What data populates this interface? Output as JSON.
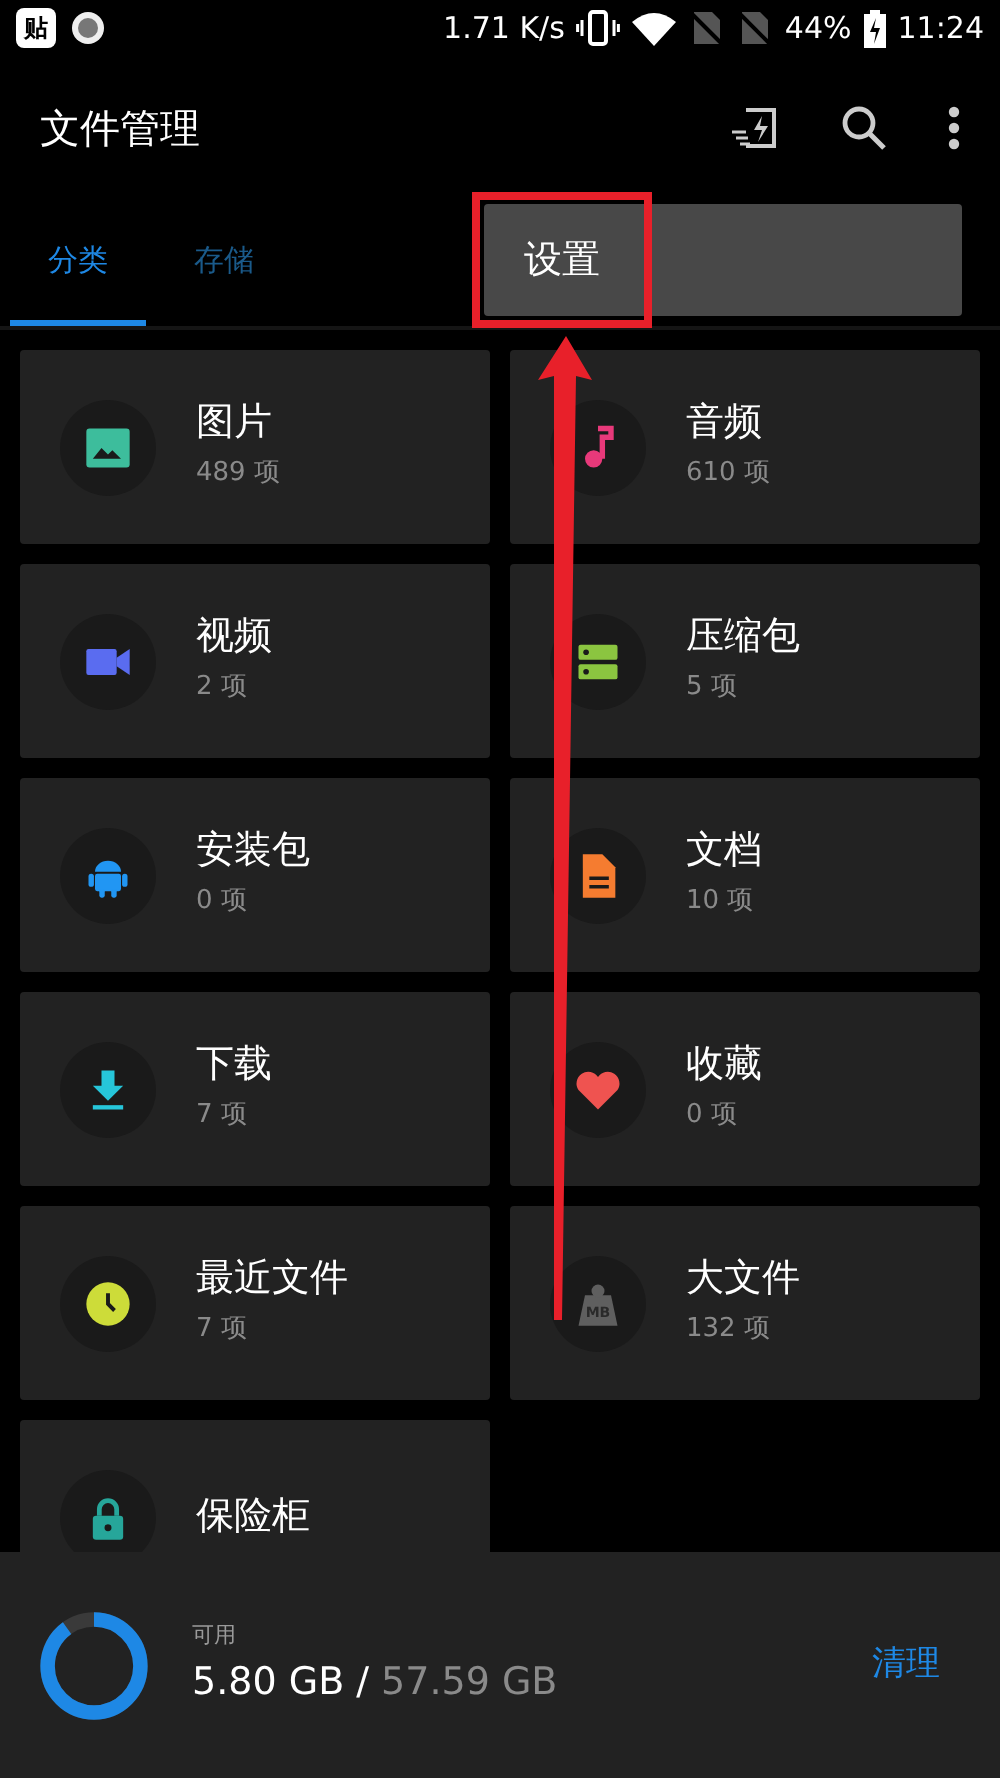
{
  "status_bar": {
    "app_badge": "贴",
    "speed": "1.71 K/s",
    "battery": "44%",
    "time": "11:24"
  },
  "app_bar": {
    "title": "文件管理"
  },
  "tabs": [
    {
      "label": "分类",
      "selected": true
    },
    {
      "label": "存储",
      "selected": false
    }
  ],
  "menu": {
    "items": [
      {
        "label": "设置",
        "highlighted": true
      }
    ]
  },
  "categories": [
    {
      "kind": "image",
      "name": "图片",
      "count": "489 项",
      "color": "#3dbd9c"
    },
    {
      "kind": "music",
      "name": "音频",
      "count": "610 项",
      "color": "#e8397a"
    },
    {
      "kind": "video",
      "name": "视频",
      "count": "2 项",
      "color": "#5a6cf0"
    },
    {
      "kind": "archive",
      "name": "压缩包",
      "count": "5 项",
      "color": "#8bc540"
    },
    {
      "kind": "android",
      "name": "安装包",
      "count": "0 项",
      "color": "#2196f3"
    },
    {
      "kind": "document",
      "name": "文档",
      "count": "10 项",
      "color": "#f57c30"
    },
    {
      "kind": "download",
      "name": "下载",
      "count": "7 项",
      "color": "#26c6da"
    },
    {
      "kind": "heart",
      "name": "收藏",
      "count": "0 项",
      "color": "#ef5350"
    },
    {
      "kind": "clock",
      "name": "最近文件",
      "count": "7 项",
      "color": "#cddc39"
    },
    {
      "kind": "weight",
      "name": "大文件",
      "count": "132 项",
      "color": "#5f5f5f",
      "icon_label": "MB"
    },
    {
      "kind": "lock",
      "name": "保险柜",
      "color": "#26a69a"
    }
  ],
  "storage": {
    "label": "可用",
    "free": "5.80 GB",
    "separator": "/",
    "total": "57.59 GB",
    "level": 0.9,
    "action": "清理"
  }
}
